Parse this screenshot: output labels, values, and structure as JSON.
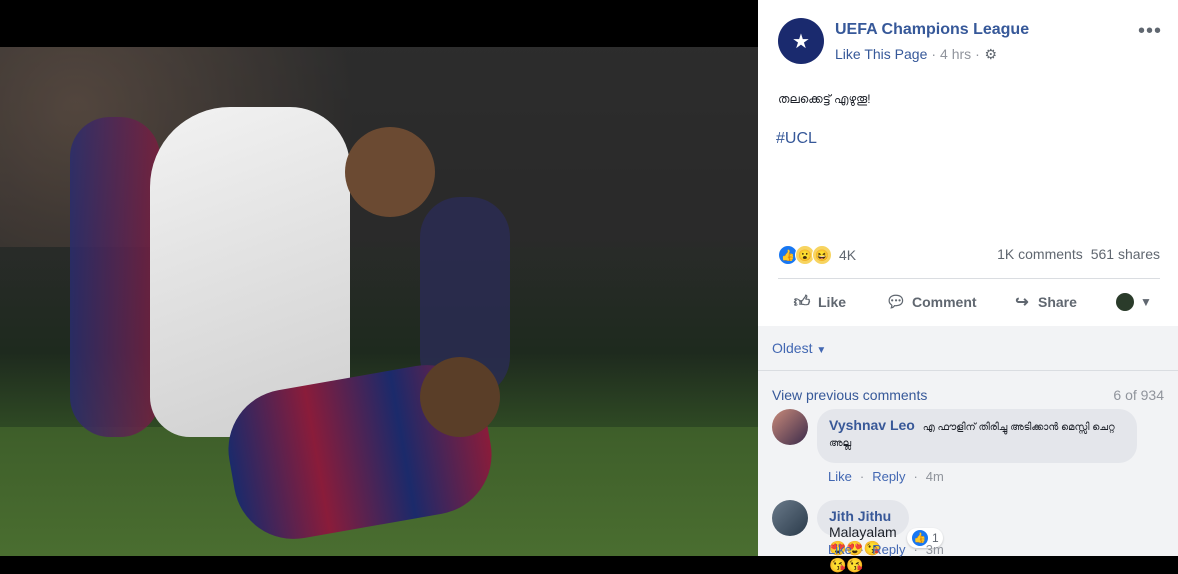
{
  "post": {
    "page_name": "UEFA Champions League",
    "like_link": "Like This Page",
    "separator": "·",
    "time": "4 hrs",
    "text": "തലക്കെട്ട് എഴുതൂ!",
    "hashtag": "#UCL",
    "avatar_icon": "ucl-logo-icon",
    "more_icon": "•••"
  },
  "stats": {
    "reactions": [
      "like",
      "wow",
      "haha"
    ],
    "reaction_count": "4K",
    "comments": "1K comments",
    "shares": "561 shares"
  },
  "actions": {
    "like": "Like",
    "comment": "Comment",
    "share": "Share"
  },
  "comments_section": {
    "sort_label": "Oldest",
    "view_previous": "View previous comments",
    "count": "6 of 934",
    "items": [
      {
        "author": "Vyshnav Leo",
        "text": "എ ഫൗളിന് തിരിച്ചു അടിക്കാൻ മെസ്സി ചെറ്റ അല്ല",
        "like": "Like",
        "reply": "Reply",
        "time": "4m"
      },
      {
        "author": "Jith Jithu",
        "text": "Malayalam",
        "emojis": "😍😍😘😘😘",
        "like": "Like",
        "reply": "Reply",
        "time": "3m",
        "reaction_count": "1"
      }
    ]
  },
  "colors": {
    "link": "#365899",
    "muted": "#90949c",
    "comment_bg": "#e4e6eb"
  }
}
